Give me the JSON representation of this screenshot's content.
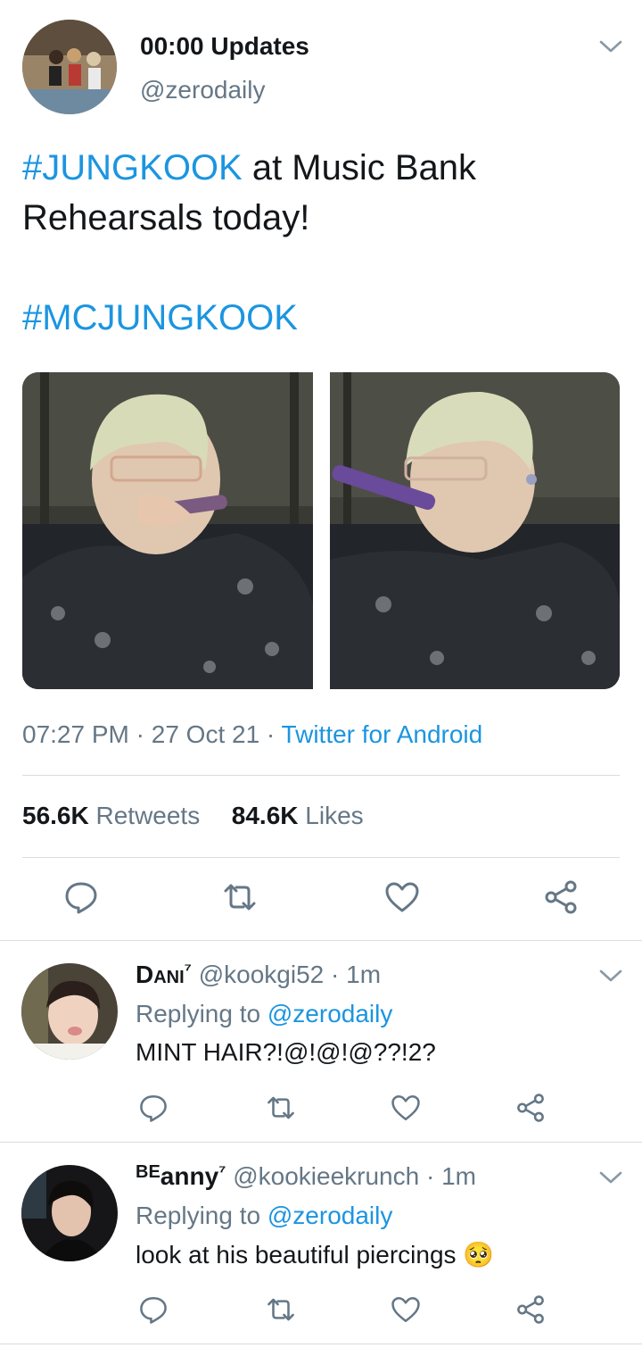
{
  "tweet": {
    "display_name": "00:00 Updates",
    "handle": "@zerodaily",
    "hashtag_1": "#JUNGKOOK",
    "text_1": " at Music Bank",
    "text_2": "Rehearsals today!",
    "hashtag_2": "#MCJUNGKOOK",
    "time": "07:27 PM",
    "sep": " · ",
    "date": "27 Oct 21",
    "client": "Twitter for Android",
    "retweets_count": "56.6K",
    "retweets_label": " Retweets",
    "likes_count": "84.6K",
    "likes_label": " Likes"
  },
  "actions": [
    "reply-icon",
    "retweet-icon",
    "like-icon",
    "share-icon"
  ],
  "replies": [
    {
      "name": "Dani",
      "name_sup": "⁷",
      "handle": "@kookgi52",
      "time": " · 1m",
      "replying_to_label": "Replying to ",
      "replying_to_handle": "@zerodaily",
      "text": "MINT HAIR?!@!@!@??!2?"
    },
    {
      "name_prefix": "BE",
      "name": "anny",
      "name_sup": "⁷",
      "handle": "@kookieekrunch",
      "time": " · 1m",
      "replying_to_label": "Replying to ",
      "replying_to_handle": "@zerodaily",
      "text": "look at his beautiful piercings ",
      "emoji": "🥺"
    }
  ],
  "colors": {
    "link": "#1b95e0",
    "secondary": "#657786",
    "divider": "#d7dde2",
    "icon": "#657786"
  }
}
